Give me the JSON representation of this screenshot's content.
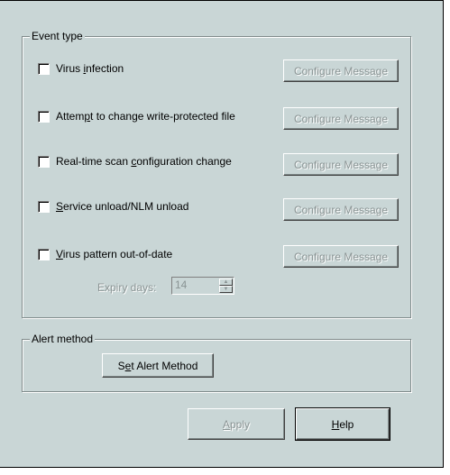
{
  "event_type": {
    "title": "Event type",
    "configure_label": "Configure Message",
    "items": [
      {
        "pre": "Virus ",
        "key": "i",
        "post": "nfection"
      },
      {
        "pre": "Attem",
        "key": "p",
        "post": "t to change write-protected file"
      },
      {
        "pre": "Real-time scan ",
        "key": "c",
        "post": "onfiguration change"
      },
      {
        "pre": "",
        "key": "S",
        "post": "ervice unload/NLM unload"
      },
      {
        "pre": "",
        "key": "V",
        "post": "irus pattern out-of-date"
      }
    ],
    "expiry": {
      "label": "Expiry days:",
      "value": "14",
      "up_icon": "▲",
      "down_icon": "▼"
    }
  },
  "alert_method": {
    "title": "Alert method",
    "button": {
      "pre": "S",
      "key": "e",
      "post": "t Alert Method"
    }
  },
  "footer": {
    "apply": {
      "pre": "",
      "key": "A",
      "post": "pply"
    },
    "help": {
      "pre": "",
      "key": "H",
      "post": "elp"
    }
  }
}
